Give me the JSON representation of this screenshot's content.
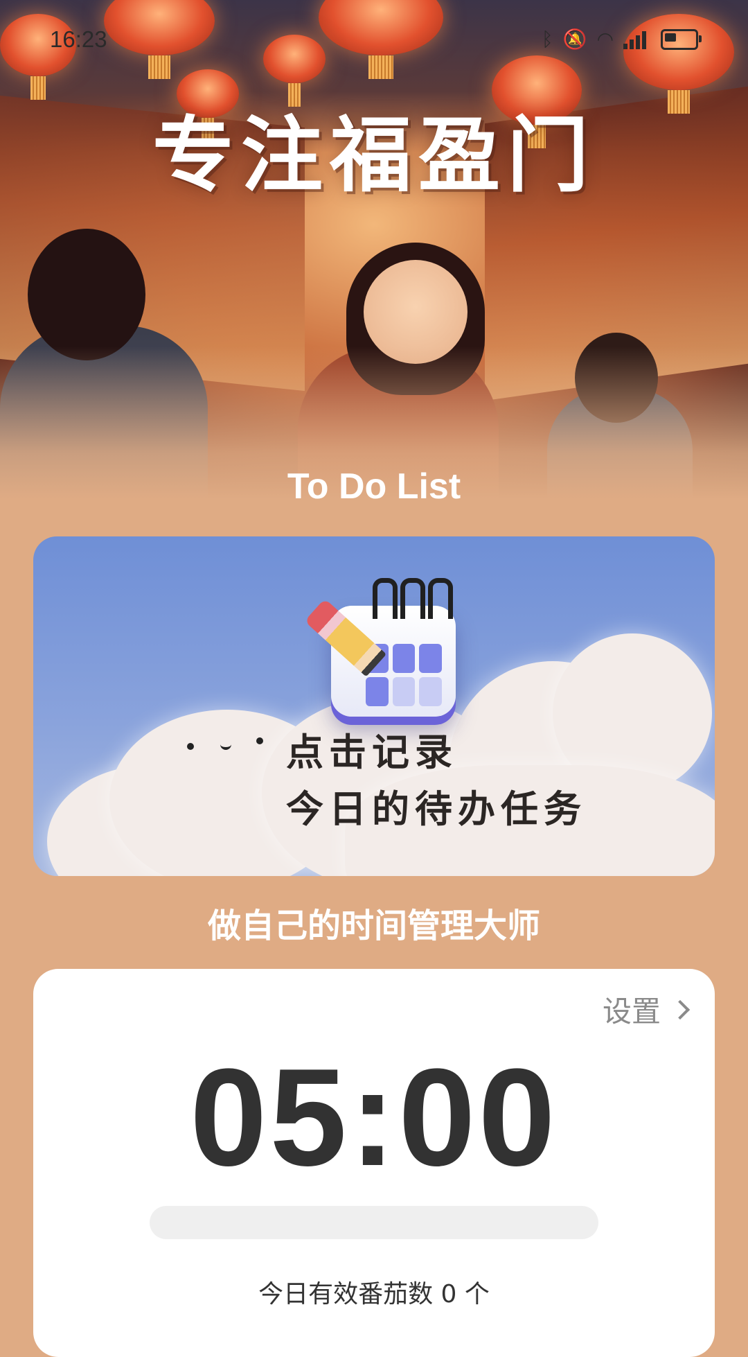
{
  "status_bar": {
    "time": "16:23",
    "icons": [
      "bluetooth-icon",
      "mute-icon",
      "wifi-icon",
      "signal-icon",
      "battery-icon"
    ]
  },
  "hero": {
    "title": "专注福盈门"
  },
  "todo": {
    "heading": "To Do List",
    "banner_line1": "点击记录",
    "banner_line2": "今日的待办任务"
  },
  "slogan": "做自己的时间管理大师",
  "timer": {
    "settings_label": "设置",
    "time": "05:00",
    "progress": 0,
    "count_text": "今日有效番茄数 0 个"
  },
  "colors": {
    "page_background": "#dfab84",
    "banner_sky": "#6f8fd6",
    "card_background": "#ffffff",
    "timer_text": "#323232"
  }
}
